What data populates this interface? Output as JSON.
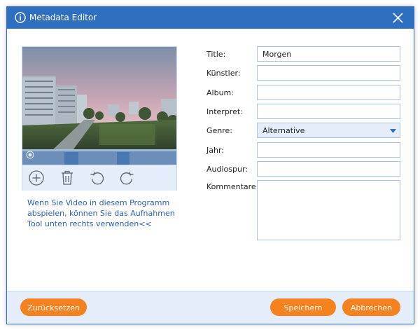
{
  "dialog": {
    "title": "Metadata Editor",
    "title_icon": "info-icon",
    "close_icon": "close-icon"
  },
  "preview": {
    "image": "video-thumbnail",
    "tools": [
      {
        "name": "add-icon"
      },
      {
        "name": "trash-icon"
      },
      {
        "name": "rotate-left-icon"
      },
      {
        "name": "rotate-right-icon"
      }
    ]
  },
  "hint_text": "Wenn Sie Video in diesem Programm abspielen, können Sie das Aufnahmen Tool unten rechts verwenden<<",
  "form": {
    "title": {
      "label": "Title:",
      "value": "Morgen"
    },
    "artist": {
      "label": "Künstler:",
      "value": ""
    },
    "album": {
      "label": "Album:",
      "value": ""
    },
    "interpreter": {
      "label": "Interpret:",
      "value": ""
    },
    "genre": {
      "label": "Genre:",
      "value": "Alternative"
    },
    "year": {
      "label": "Jahr:",
      "value": ""
    },
    "track": {
      "label": "Audiospur:",
      "value": ""
    },
    "comments": {
      "label": "Kommentare:",
      "value": ""
    }
  },
  "buttons": {
    "reset": "Zurücksetzen",
    "save": "Speichern",
    "cancel": "Abbrechen"
  },
  "colors": {
    "titlebar": "#2f6fbf",
    "accent_button": "#f5821f",
    "panel_bg": "#e4eefa",
    "hint_text": "#2a62b5"
  }
}
